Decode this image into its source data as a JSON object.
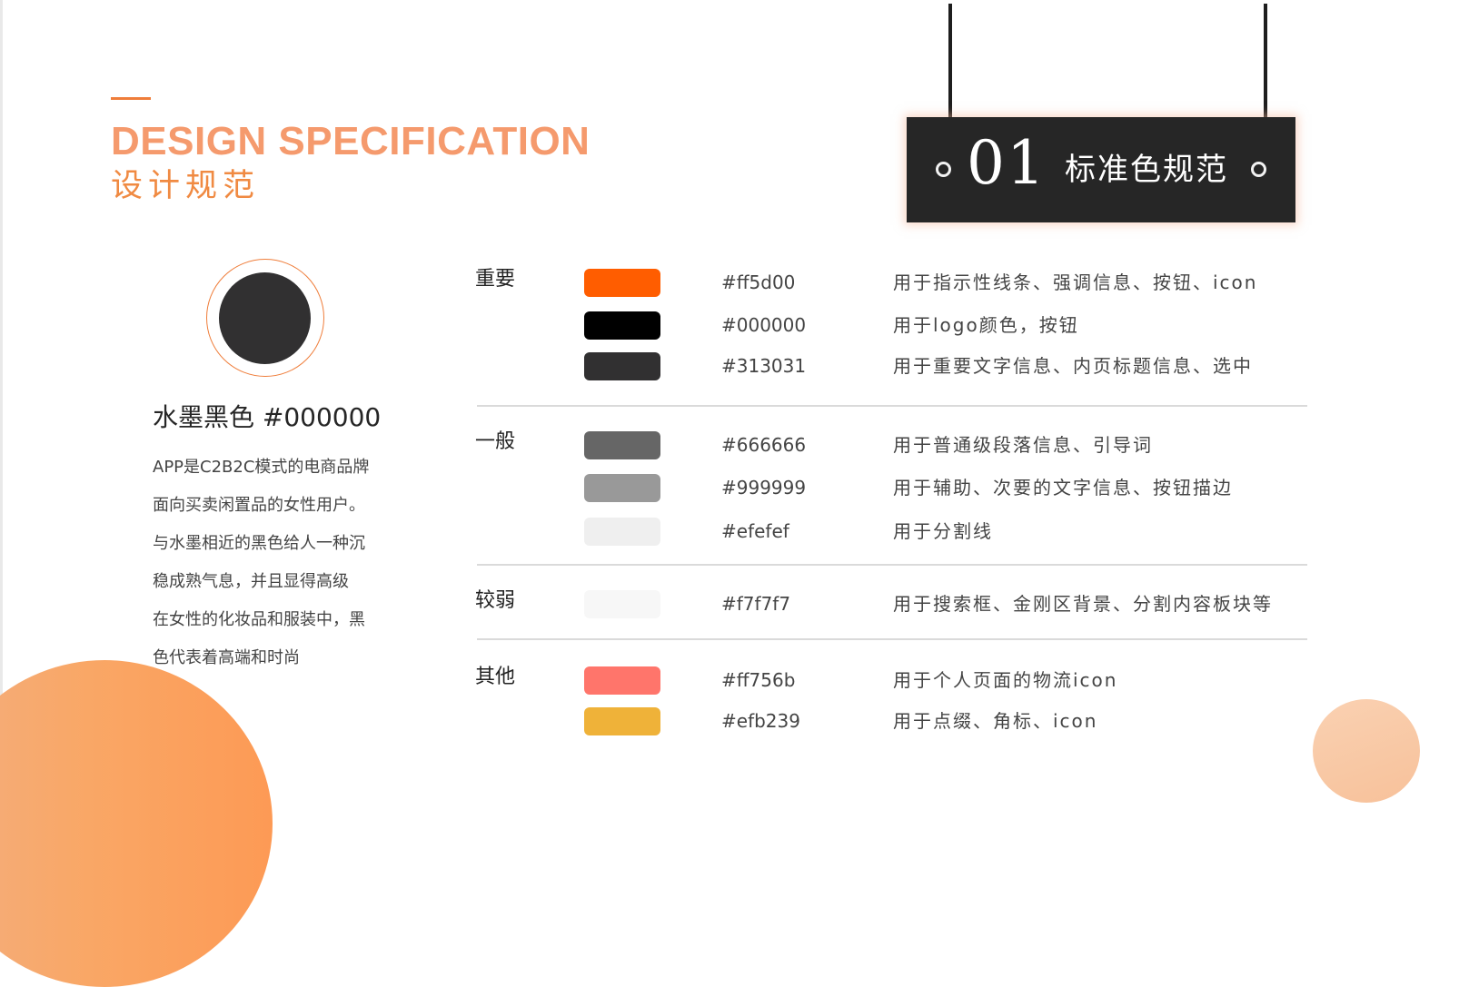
{
  "header": {
    "title_en": "DESIGN SPECIFICATION",
    "title_cn": "设计规范"
  },
  "sign": {
    "number": "01",
    "title": "标准色规范"
  },
  "preview": {
    "title": "水墨黑色 #000000",
    "color": "#313031",
    "ring_color": "#ef7d3a",
    "description": [
      "APP是C2B2C模式的电商品牌",
      "面向买卖闲置品的女性用户。",
      "与水墨相近的黑色给人一种沉",
      "稳成熟气息，并且显得高级",
      "在女性的化妆品和服装中，黑",
      "色代表着高端和时尚"
    ]
  },
  "groups": [
    {
      "label": "重要",
      "colors": [
        {
          "hex": "#ff5d00",
          "usage": "用于指示性线条、强调信息、按钮、icon"
        },
        {
          "hex": "#000000",
          "usage": "用于logo颜色，按钮"
        },
        {
          "hex": "#313031",
          "usage": "用于重要文字信息、内页标题信息、选中"
        }
      ]
    },
    {
      "label": "一般",
      "colors": [
        {
          "hex": "#666666",
          "usage": "用于普通级段落信息、引导词"
        },
        {
          "hex": "#999999",
          "usage": "用于辅助、次要的文字信息、按钮描边"
        },
        {
          "hex": "#efefef",
          "usage": "用于分割线"
        }
      ]
    },
    {
      "label": "较弱",
      "colors": [
        {
          "hex": "#f7f7f7",
          "usage": "用于搜索框、金刚区背景、分割内容板块等"
        }
      ]
    },
    {
      "label": "其他",
      "colors": [
        {
          "hex": "#ff756b",
          "usage": "用于个人页面的物流icon"
        },
        {
          "hex": "#efb239",
          "usage": "用于点缀、角标、icon"
        }
      ]
    }
  ]
}
